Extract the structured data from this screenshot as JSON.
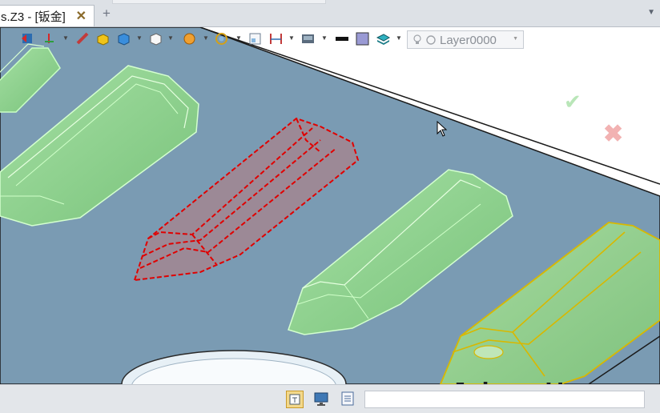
{
  "tabbar": {
    "document_tab_label": "s.Z3 - [钣金]",
    "close_icon": "close-x-icon",
    "add_tab_icon": "plus-icon",
    "menu_icon": "chevron-down-icon"
  },
  "toolbar": {
    "icons": [
      "exit-sketch-icon",
      "axis-icon",
      "ruler-icon",
      "box-yellow-icon",
      "cube-blue-icon",
      "cube-white-icon",
      "sphere-orange-icon",
      "circle-view-icon",
      "view-grid-icon",
      "dimension-icon",
      "display-mode-icon",
      "line-color-icon",
      "fill-color-icon",
      "layer-3d-icon"
    ],
    "layer_label": "Layer0000",
    "layer_icons": [
      "bulb-icon",
      "circle-icon"
    ]
  },
  "viewport": {
    "confirm_icon": "checkmark-icon",
    "cancel_icon": "cross-icon",
    "watermark": "JohnnyHuang",
    "colors": {
      "background": "#ffffff",
      "plate": "#7a9bb3",
      "emboss_fill": "#8fd18f",
      "selected_outline": "#e00000",
      "highlight_outline": "#d8b800"
    }
  },
  "statusbar": {
    "icons": [
      "text-frame-icon",
      "monitor-icon",
      "document-list-icon"
    ],
    "input_value": ""
  }
}
